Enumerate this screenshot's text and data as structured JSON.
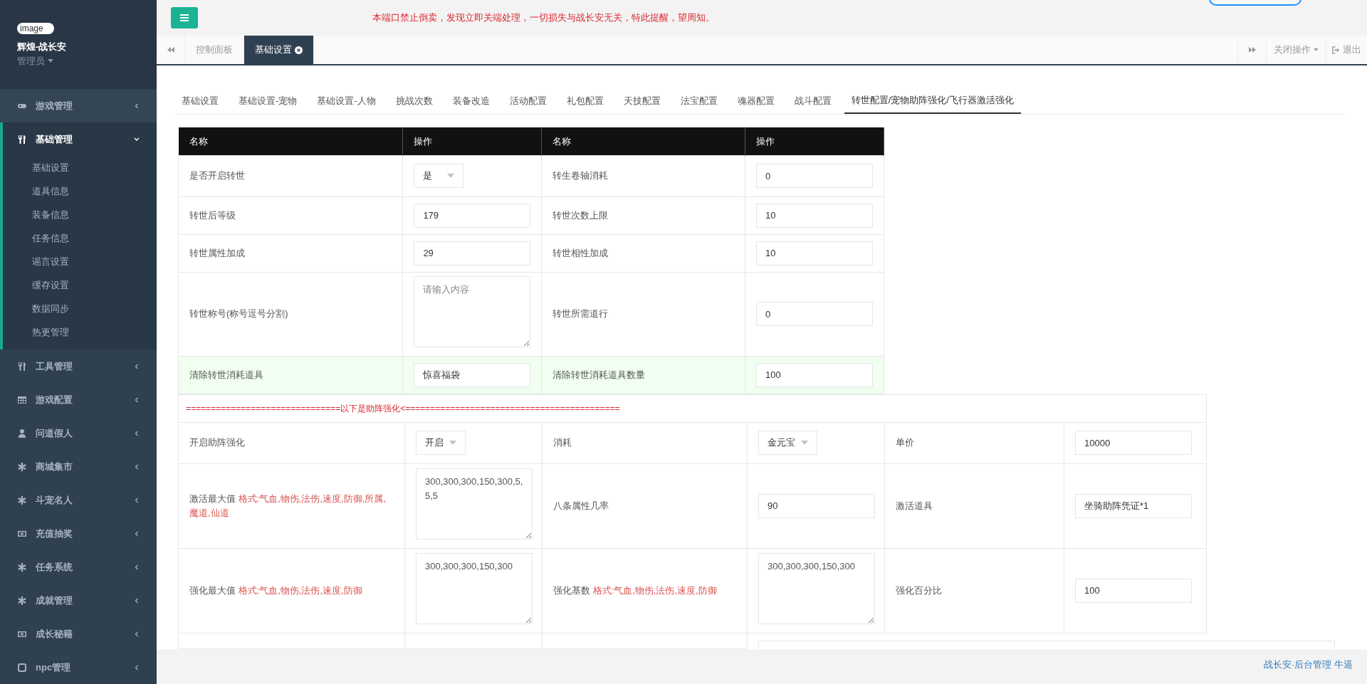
{
  "profile": {
    "name": "辉煌-战长安",
    "role": "管理员",
    "image_label": "image"
  },
  "sidebar": {
    "items": [
      {
        "label": "游戏管理",
        "expanded": false
      },
      {
        "label": "基础管理",
        "expanded": true,
        "children": [
          {
            "label": "基础设置"
          },
          {
            "label": "道具信息"
          },
          {
            "label": "装备信息"
          },
          {
            "label": "任务信息"
          },
          {
            "label": "谣言设置"
          },
          {
            "label": "缓存设置"
          },
          {
            "label": "数据同步"
          },
          {
            "label": "热更管理"
          }
        ]
      },
      {
        "label": "工具管理",
        "expanded": false
      },
      {
        "label": "游戏配置",
        "expanded": false
      },
      {
        "label": "问道假人",
        "expanded": false
      },
      {
        "label": "商城集市",
        "expanded": false
      },
      {
        "label": "斗宠名人",
        "expanded": false
      },
      {
        "label": "充值抽奖",
        "expanded": false
      },
      {
        "label": "任务系统",
        "expanded": false
      },
      {
        "label": "成就管理",
        "expanded": false
      },
      {
        "label": "成长秘籍",
        "expanded": false
      },
      {
        "label": "npc管理",
        "expanded": false
      }
    ]
  },
  "notice": "本端口禁止倒卖，发现立即关端处理，一切损失与战长安无关，特此提醒，望周知。",
  "page_tabs": [
    {
      "label": "控制面板",
      "selected": false
    },
    {
      "label": "基础设置",
      "selected": true
    }
  ],
  "page_tab_actions": {
    "close_menu": "关闭操作",
    "logout": "退出"
  },
  "settings_tabs": [
    {
      "label": "基础设置",
      "selected": false
    },
    {
      "label": "基础设置-宠物",
      "selected": false
    },
    {
      "label": "基础设置-人物",
      "selected": false
    },
    {
      "label": "挑战次数",
      "selected": false
    },
    {
      "label": "装备改造",
      "selected": false
    },
    {
      "label": "活动配置",
      "selected": false
    },
    {
      "label": "礼包配置",
      "selected": false
    },
    {
      "label": "天技配置",
      "selected": false
    },
    {
      "label": "法宝配置",
      "selected": false
    },
    {
      "label": "魂器配置",
      "selected": false
    },
    {
      "label": "战斗配置",
      "selected": false
    },
    {
      "label": "转世配置/宠物助阵强化/飞行器激活强化",
      "selected": true
    }
  ],
  "table": {
    "columns": [
      "名称",
      "操作",
      "名称",
      "操作"
    ],
    "rows": [
      {
        "highlighted": false,
        "cells": [
          {
            "label": "是否开启转世",
            "field": {
              "kind": "select",
              "value": "是"
            }
          },
          {
            "label": "转生卷轴消耗",
            "field": {
              "kind": "input",
              "value": "0"
            }
          }
        ]
      },
      {
        "highlighted": false,
        "cells": [
          {
            "label": "转世后等级",
            "field": {
              "kind": "input",
              "value": "179"
            }
          },
          {
            "label": "转世次数上限",
            "field": {
              "kind": "input",
              "value": "10"
            }
          }
        ]
      },
      {
        "highlighted": false,
        "cells": [
          {
            "label": "转世属性加成",
            "field": {
              "kind": "input",
              "value": "29"
            }
          },
          {
            "label": "转世相性加成",
            "field": {
              "kind": "input",
              "value": "10"
            }
          }
        ]
      },
      {
        "highlighted": false,
        "cells": [
          {
            "label": "转世称号(称号逗号分割)",
            "field": {
              "kind": "textarea",
              "placeholder": "请输入内容"
            }
          },
          {
            "label": "转世所需道行",
            "field": {
              "kind": "input",
              "value": "0"
            }
          }
        ]
      },
      {
        "highlighted": true,
        "cells": [
          {
            "label": "清除转世消耗道具",
            "field": {
              "kind": "input",
              "value": "惊喜福袋"
            }
          },
          {
            "label": "清除转世消耗道具数量",
            "field": {
              "kind": "input",
              "value": "100"
            }
          }
        ]
      }
    ]
  },
  "section_banner": "===============================以下是助阵强化<===========================================",
  "pet_table": {
    "rows": [
      {
        "cells": [
          {
            "label": "开启助阵强化",
            "field": {
              "kind": "select",
              "value": "开启"
            }
          },
          {
            "label": "消耗",
            "field": {
              "kind": "select",
              "value": "金元宝"
            }
          },
          {
            "label": "单价",
            "field": {
              "kind": "input",
              "value": "10000"
            }
          }
        ]
      },
      {
        "cells": [
          {
            "label": "激活最大值",
            "hint": "格式:气血,物伤,法伤,速度,防御,所属,魔道,仙道",
            "field": {
              "kind": "textarea",
              "value": "300,300,300,150,300,5,5,5"
            }
          },
          {
            "label": "八条属性几率",
            "field": {
              "kind": "input",
              "value": "90"
            }
          },
          {
            "label": "激活道具",
            "field": {
              "kind": "input",
              "value": "坐骑助阵凭证*1"
            }
          }
        ]
      },
      {
        "cells": [
          {
            "label": "强化最大值",
            "hint": "格式:气血,物伤,法伤,速度,防御",
            "field": {
              "kind": "textarea",
              "value": "300,300,300,150,300"
            }
          },
          {
            "label": "强化基数",
            "hint": "格式:气血,物伤,法伤,速度,防御",
            "field": {
              "kind": "textarea",
              "value": "300,300,300,150,300"
            }
          },
          {
            "label": "强化百分比",
            "field": {
              "kind": "input",
              "value": "100"
            }
          }
        ]
      }
    ]
  },
  "footer": "战长安·后台管理 牛逼"
}
